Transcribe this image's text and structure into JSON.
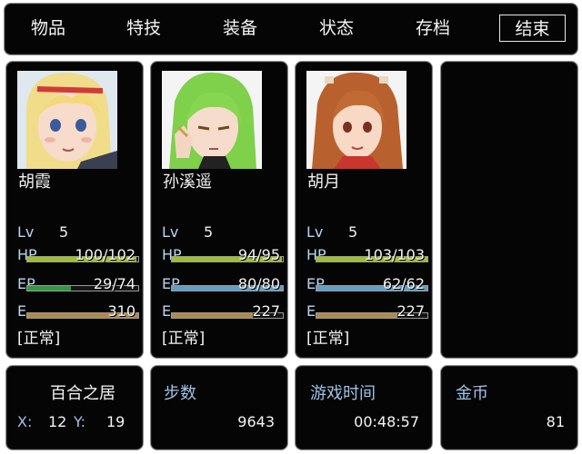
{
  "menu": {
    "items": [
      "物品",
      "特技",
      "装备",
      "状态",
      "存档",
      "结束"
    ],
    "selected_index": 5
  },
  "stat_labels": {
    "lv": "Lv",
    "hp": "HP",
    "ep": "EP",
    "e": "E"
  },
  "characters": [
    {
      "name": "胡霞",
      "lv": "5",
      "hp": "100/102",
      "hp_ratio": 0.98,
      "ep": "29/74",
      "ep_ratio": 0.39,
      "e": "310",
      "e_ratio": 1.0,
      "status": "[正常]"
    },
    {
      "name": "孙溪遥",
      "lv": "5",
      "hp": "94/95",
      "hp_ratio": 0.99,
      "ep": "80/80",
      "ep_ratio": 1.0,
      "e": "227",
      "e_ratio": 0.73,
      "status": "[正常]"
    },
    {
      "name": "胡月",
      "lv": "5",
      "hp": "103/103",
      "hp_ratio": 1.0,
      "ep": "62/62",
      "ep_ratio": 1.0,
      "e": "227",
      "e_ratio": 0.73,
      "status": "[正常]"
    }
  ],
  "location": {
    "name": "百合之居",
    "x_label": "X:",
    "x": "12",
    "y_label": "Y:",
    "y": "19"
  },
  "steps": {
    "label": "步数",
    "value": "9643"
  },
  "play_time": {
    "label": "游戏时间",
    "value": "00:48:57"
  },
  "gold": {
    "label": "金币",
    "value": "81"
  },
  "colors": {
    "hp_bar": "#9fbf2f",
    "ep_bar_low": "#2f9a3f",
    "ep_bar": "#5fa0c8",
    "e_bar": "#b08a4a",
    "label_blue": "#9fc2e6"
  }
}
